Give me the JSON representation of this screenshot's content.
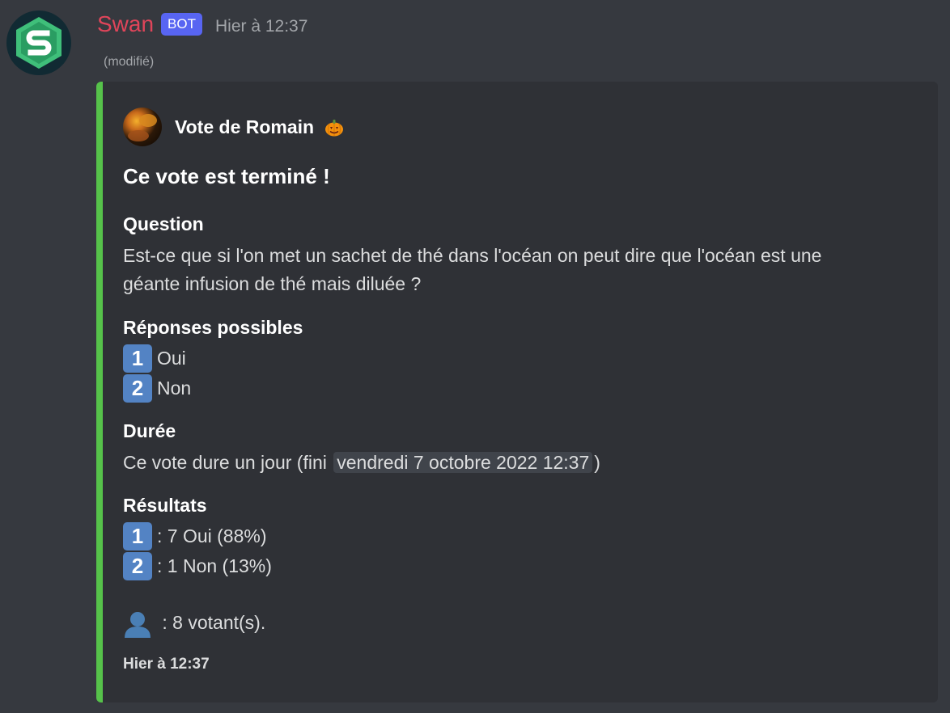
{
  "message": {
    "username": "Swan",
    "bot_tag": "BOT",
    "timestamp": "Hier à 12:37",
    "edited": "(modifié)",
    "avatar_icon": "shield-s-logo"
  },
  "embed": {
    "accent_color": "#56c24a",
    "author": {
      "name": "Vote de Romain",
      "emoji": "pumpkin-icon"
    },
    "title": "Ce vote est terminé !",
    "fields": {
      "question": {
        "name": "Question",
        "line1": "Est-ce que si l'on met un sachet de thé dans l'océan on peut dire que l'océan est une",
        "line2": "géante infusion de thé mais diluée ?"
      },
      "responses": {
        "name": "Réponses possibles",
        "items": [
          {
            "key": "1",
            "label": "Oui"
          },
          {
            "key": "2",
            "label": "Non"
          }
        ]
      },
      "duration": {
        "name": "Durée",
        "prefix": "Ce vote dure un jour (fini",
        "date": "vendredi 7 octobre 2022 12:37",
        "suffix": ")"
      },
      "results": {
        "name": "Résultats",
        "items": [
          {
            "key": "1",
            "text": ": 7 Oui (88%)"
          },
          {
            "key": "2",
            "text": ": 1 Non (13%)"
          }
        ]
      },
      "voters": {
        "icon": "bust-silhouette-icon",
        "text": ": 8 votant(s)."
      }
    },
    "footer": "Hier à 12:37"
  }
}
